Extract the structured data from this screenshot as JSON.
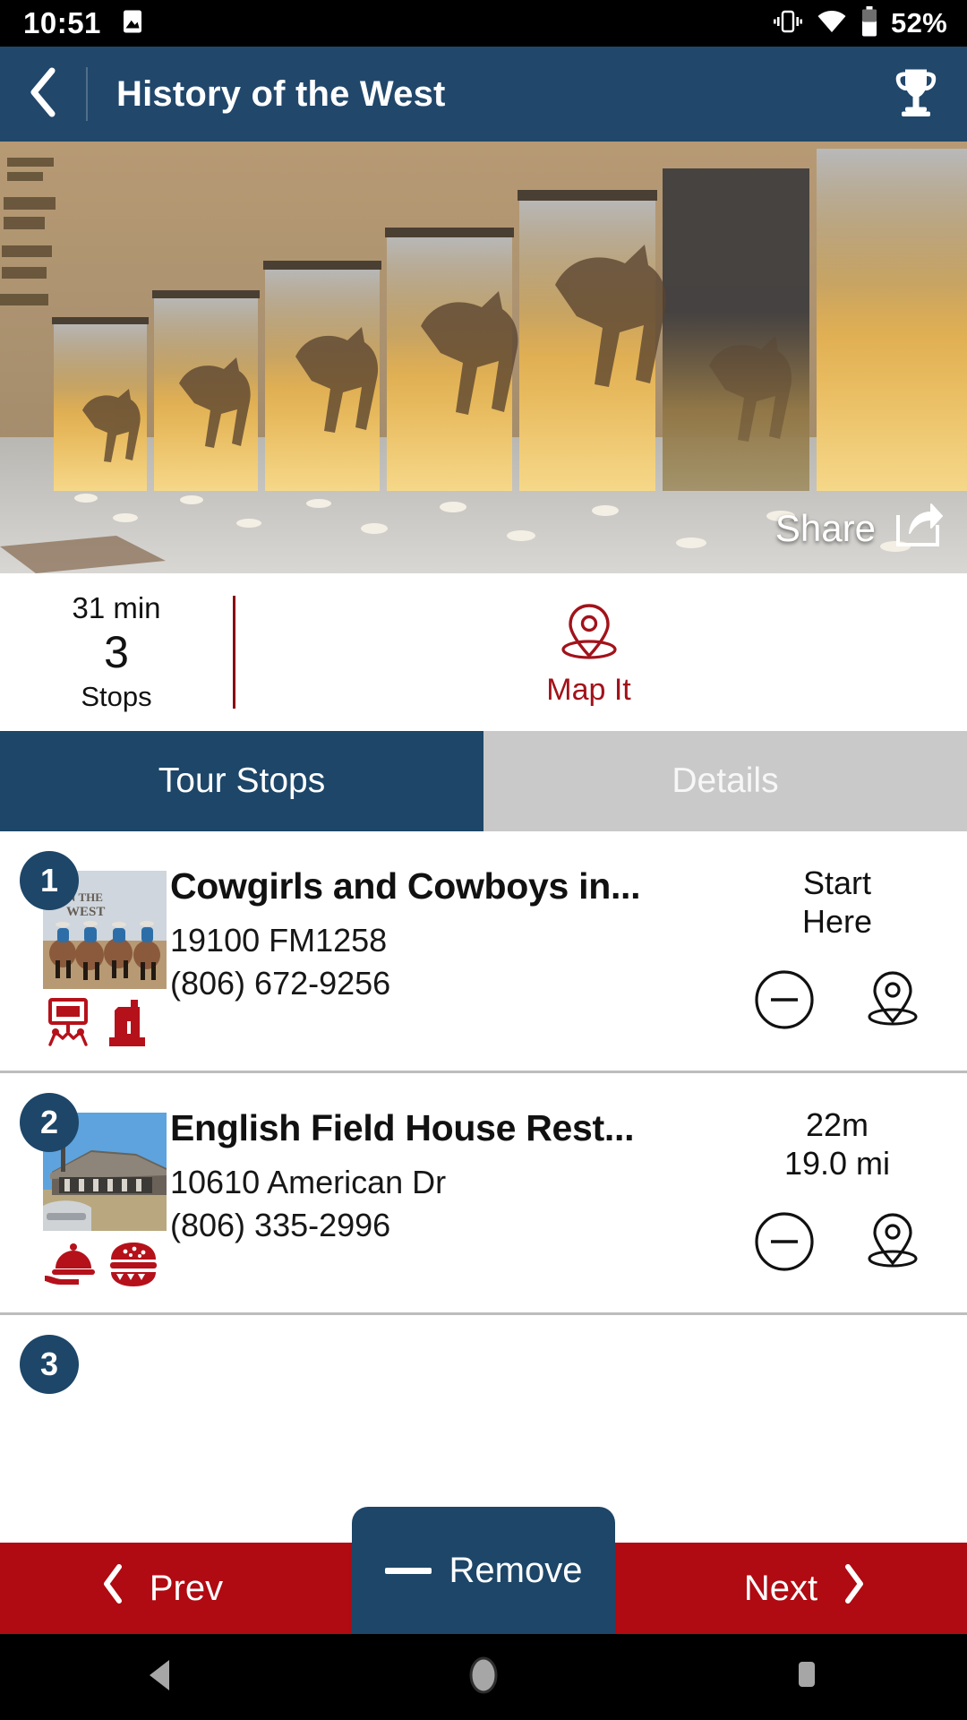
{
  "status_bar": {
    "time": "10:51",
    "image_icon": "image-icon",
    "vibrate_icon": "vibrate-icon",
    "wifi_icon": "wifi-icon",
    "battery_icon": "battery-icon",
    "battery_percent": "52%"
  },
  "header": {
    "back_icon": "back-chevron-icon",
    "title": "History of the West",
    "trophy_icon": "trophy-icon",
    "background_color": "#21476b"
  },
  "hero": {
    "alt": "Glass panels with horse silhouettes at dusk",
    "share_label": "Share",
    "share_icon": "share-icon"
  },
  "stats": {
    "duration": "31 min",
    "stop_count": "3",
    "stop_label": "Stops",
    "divider_color": "#8c0b13",
    "map_it_label": "Map It",
    "map_it_icon": "map-pin-icon",
    "accent_color": "#a2121a"
  },
  "tabs": [
    {
      "label": "Tour Stops",
      "active": true
    },
    {
      "label": "Details",
      "active": false
    }
  ],
  "stops": [
    {
      "number": "1",
      "title": "Cowgirls and Cowboys in...",
      "address": "19100 FM1258",
      "phone": "(806) 672-9256",
      "meta_line1": "Start",
      "meta_line2": "Here",
      "categories": [
        "exhibit-icon",
        "monument-icon"
      ],
      "remove_icon": "minus-circle-icon",
      "map_icon": "map-pin-outline-icon"
    },
    {
      "number": "2",
      "title": "English Field House Rest...",
      "address": "10610 American Dr",
      "phone": "(806) 335-2996",
      "meta_line1": "22m",
      "meta_line2": "19.0 mi",
      "categories": [
        "dining-tray-icon",
        "burger-icon"
      ],
      "remove_icon": "minus-circle-icon",
      "map_icon": "map-pin-outline-icon"
    },
    {
      "number": "3",
      "title": "",
      "address": "",
      "phone": "",
      "meta_line1": "",
      "meta_line2": "",
      "categories": [],
      "remove_icon": "minus-circle-icon",
      "map_icon": "map-pin-outline-icon"
    }
  ],
  "bottom_bar": {
    "prev_label": "Prev",
    "prev_icon": "chevron-left-icon",
    "next_label": "Next",
    "next_icon": "chevron-right-icon",
    "remove_label": "Remove",
    "remove_icon": "minus-dash-icon",
    "background_color": "#b00a12",
    "remove_background_color": "#1d4668"
  },
  "nav_bar": {
    "back_icon": "android-back-icon",
    "home_icon": "android-home-icon",
    "recents_icon": "android-recents-icon"
  }
}
